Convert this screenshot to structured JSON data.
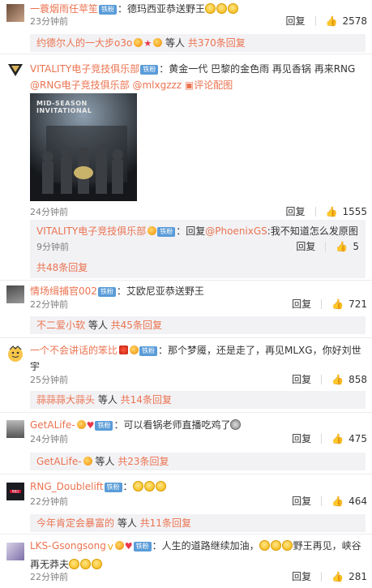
{
  "comments": [
    {
      "user": "一蓑烟雨任苹笙",
      "badge": "铁粉",
      "text": "：德玛西亚恭送野王",
      "time": "23分钟前",
      "reply_label": "回复",
      "likes": "2578",
      "sub_summary": {
        "name": "约德尔人的一大步o3o",
        "mid": " 等人",
        "count": "共370条回复"
      }
    },
    {
      "user": "VITALITY电子竞技俱乐部",
      "badge": "铁粉",
      "text": "：黄金一代 巴黎的金色雨 再见香锅 再来RNG",
      "mention1": "@RNG电子竞技俱乐部",
      "mention2": "@mlxgzzz",
      "pic_link": "评论配图",
      "photo_caption": "MID-SEASON INVITATIONAL",
      "time": "24分钟前",
      "reply_label": "回复",
      "likes": "1555",
      "sub_reply": {
        "user": "VITALITY电子竞技俱乐部",
        "badge": "铁粉",
        "text_prefix": "：回复",
        "mention": "@PhoenixGS",
        "text": ":我不知道怎么发原图",
        "time": "9分钟前",
        "reply_label": "回复",
        "likes": "5"
      },
      "sub_total": "共48条回复"
    },
    {
      "user": "情场缉捕官002",
      "badge": "铁粉",
      "text": "：艾欧尼亚恭送野王",
      "time": "22分钟前",
      "reply_label": "回复",
      "likes": "721",
      "sub_summary": {
        "name": "不二爱小软",
        "mid": " 等人",
        "count": "共45条回复"
      }
    },
    {
      "user": "一个不会讲话的笨比",
      "badge": "铁粉",
      "text": "：那个梦魇，还是走了，再见MLXG，你好刘世宇",
      "time": "25分钟前",
      "reply_label": "回复",
      "likes": "858",
      "sub_summary": {
        "name": "蒜蒜蒜大蒜头",
        "mid": " 等人",
        "count": "共14条回复"
      }
    },
    {
      "user": "GetALife-",
      "badge": "铁粉",
      "text": "：可以看锅老师直播吃鸡了",
      "time": "24分钟前",
      "reply_label": "回复",
      "likes": "475",
      "sub_summary": {
        "name": "GetALife-",
        "mid": " 等人",
        "count": "共23条回复"
      }
    },
    {
      "user": "RNG_Doublelift",
      "badge": "铁粉",
      "text": "：",
      "time": "22分钟前",
      "reply_label": "回复",
      "likes": "464",
      "sub_summary": {
        "name": "今年肯定会暴富的",
        "mid": " 等人",
        "count": "共11条回复"
      }
    },
    {
      "user": "LKS-Gsongsong",
      "badge": "铁粉",
      "text": "：人生的道路继续加油，",
      "text2": "野王再见，峡谷再无莽夫",
      "time": "22分钟前",
      "reply_label": "回复",
      "likes": "281"
    }
  ],
  "icons": {
    "like": "thumbs-up-icon",
    "emoji": "cry-laugh-emoji-icon",
    "medal": "fan-medal-icon"
  },
  "colors": {
    "link": "#eb7350",
    "badge": "#5a9cd8",
    "reply_bg": "#f2f2f5"
  }
}
